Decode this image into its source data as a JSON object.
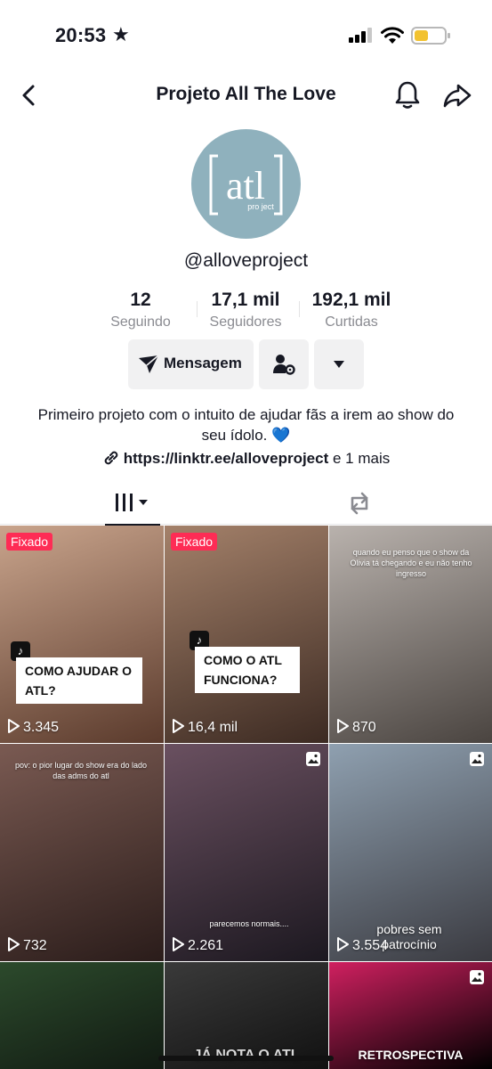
{
  "status_bar": {
    "time": "20:53",
    "star": "★"
  },
  "nav": {
    "title": "Projeto All The Love"
  },
  "profile": {
    "avatar_text": "atl",
    "avatar_sub": "pro ject",
    "handle": "@alloveproject",
    "stats": [
      {
        "value": "12",
        "label": "Seguindo"
      },
      {
        "value": "17,1 mil",
        "label": "Seguidores"
      },
      {
        "value": "192,1 mil",
        "label": "Curtidas"
      }
    ],
    "message_label": "Mensagem",
    "bio": "Primeiro projeto com o intuito de ajudar fãs a irem ao show do seu ídolo.",
    "bio_emoji": "💙",
    "link": "https://linktr.ee/alloveproject",
    "link_more": "e 1 mais"
  },
  "videos": [
    {
      "pinned": "Fixado",
      "caption": "COMO AJUDAR O ATL?",
      "views": "3.345",
      "bg": [
        "#c9a48c",
        "#5a3a2c"
      ]
    },
    {
      "pinned": "Fixado",
      "caption": "COMO O ATL FUNCIONA?",
      "views": "16,4 mil",
      "bg": [
        "#a4816a",
        "#3c2a22"
      ]
    },
    {
      "overlay": "quando eu penso que o show da Olivia tá chegando e eu não tenho ingresso",
      "views": "870",
      "bg": [
        "#b9b2ad",
        "#4a4440"
      ]
    },
    {
      "overlay": "pov: o pior lugar do show era do lado das adms do atl",
      "views": "732",
      "bg": [
        "#7a5a52",
        "#2a1c1a"
      ]
    },
    {
      "overlay": "parecemos normais....",
      "views": "2.261",
      "bg": [
        "#6a5060",
        "#1c1820"
      ],
      "photo": true
    },
    {
      "overlay": "pobres sem patrocínio",
      "views": "3.554",
      "bg": [
        "#8fa0b0",
        "#3a3a40"
      ],
      "photo": true
    },
    {
      "views": "",
      "bg": [
        "#2c4a2c",
        "#111a12"
      ]
    },
    {
      "overlay": "JÁ NOTA O ATL",
      "views": "",
      "bg": [
        "#3a3a3a",
        "#111111"
      ]
    },
    {
      "overlay": "RETROSPECTIVA",
      "views": "",
      "bg": [
        "#d02060",
        "#000000"
      ],
      "photo": true
    }
  ],
  "colors": {
    "accent": "#fe2c55",
    "text": "#161823",
    "muted": "#8a8b91",
    "button_bg": "#f1f1f2"
  }
}
